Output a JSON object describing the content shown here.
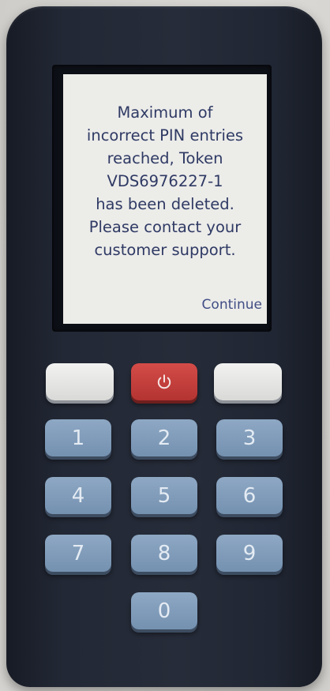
{
  "screen": {
    "lines": [
      "Maximum of",
      "incorrect PIN entries",
      "reached, Token",
      "VDS6976227-1",
      "has been deleted.",
      "Please contact your",
      "customer support."
    ],
    "continue_label": "Continue"
  },
  "keypad": {
    "power_icon": "power-icon",
    "keys": [
      "1",
      "2",
      "3",
      "4",
      "5",
      "6",
      "7",
      "8",
      "9",
      "0"
    ]
  },
  "colors": {
    "device_body": "#232938",
    "screen_bg": "#ecece9",
    "screen_text": "#2f3a64",
    "power_key": "#c43e3c",
    "number_key": "#8ea8c4",
    "soft_key": "#e6e6e4"
  }
}
